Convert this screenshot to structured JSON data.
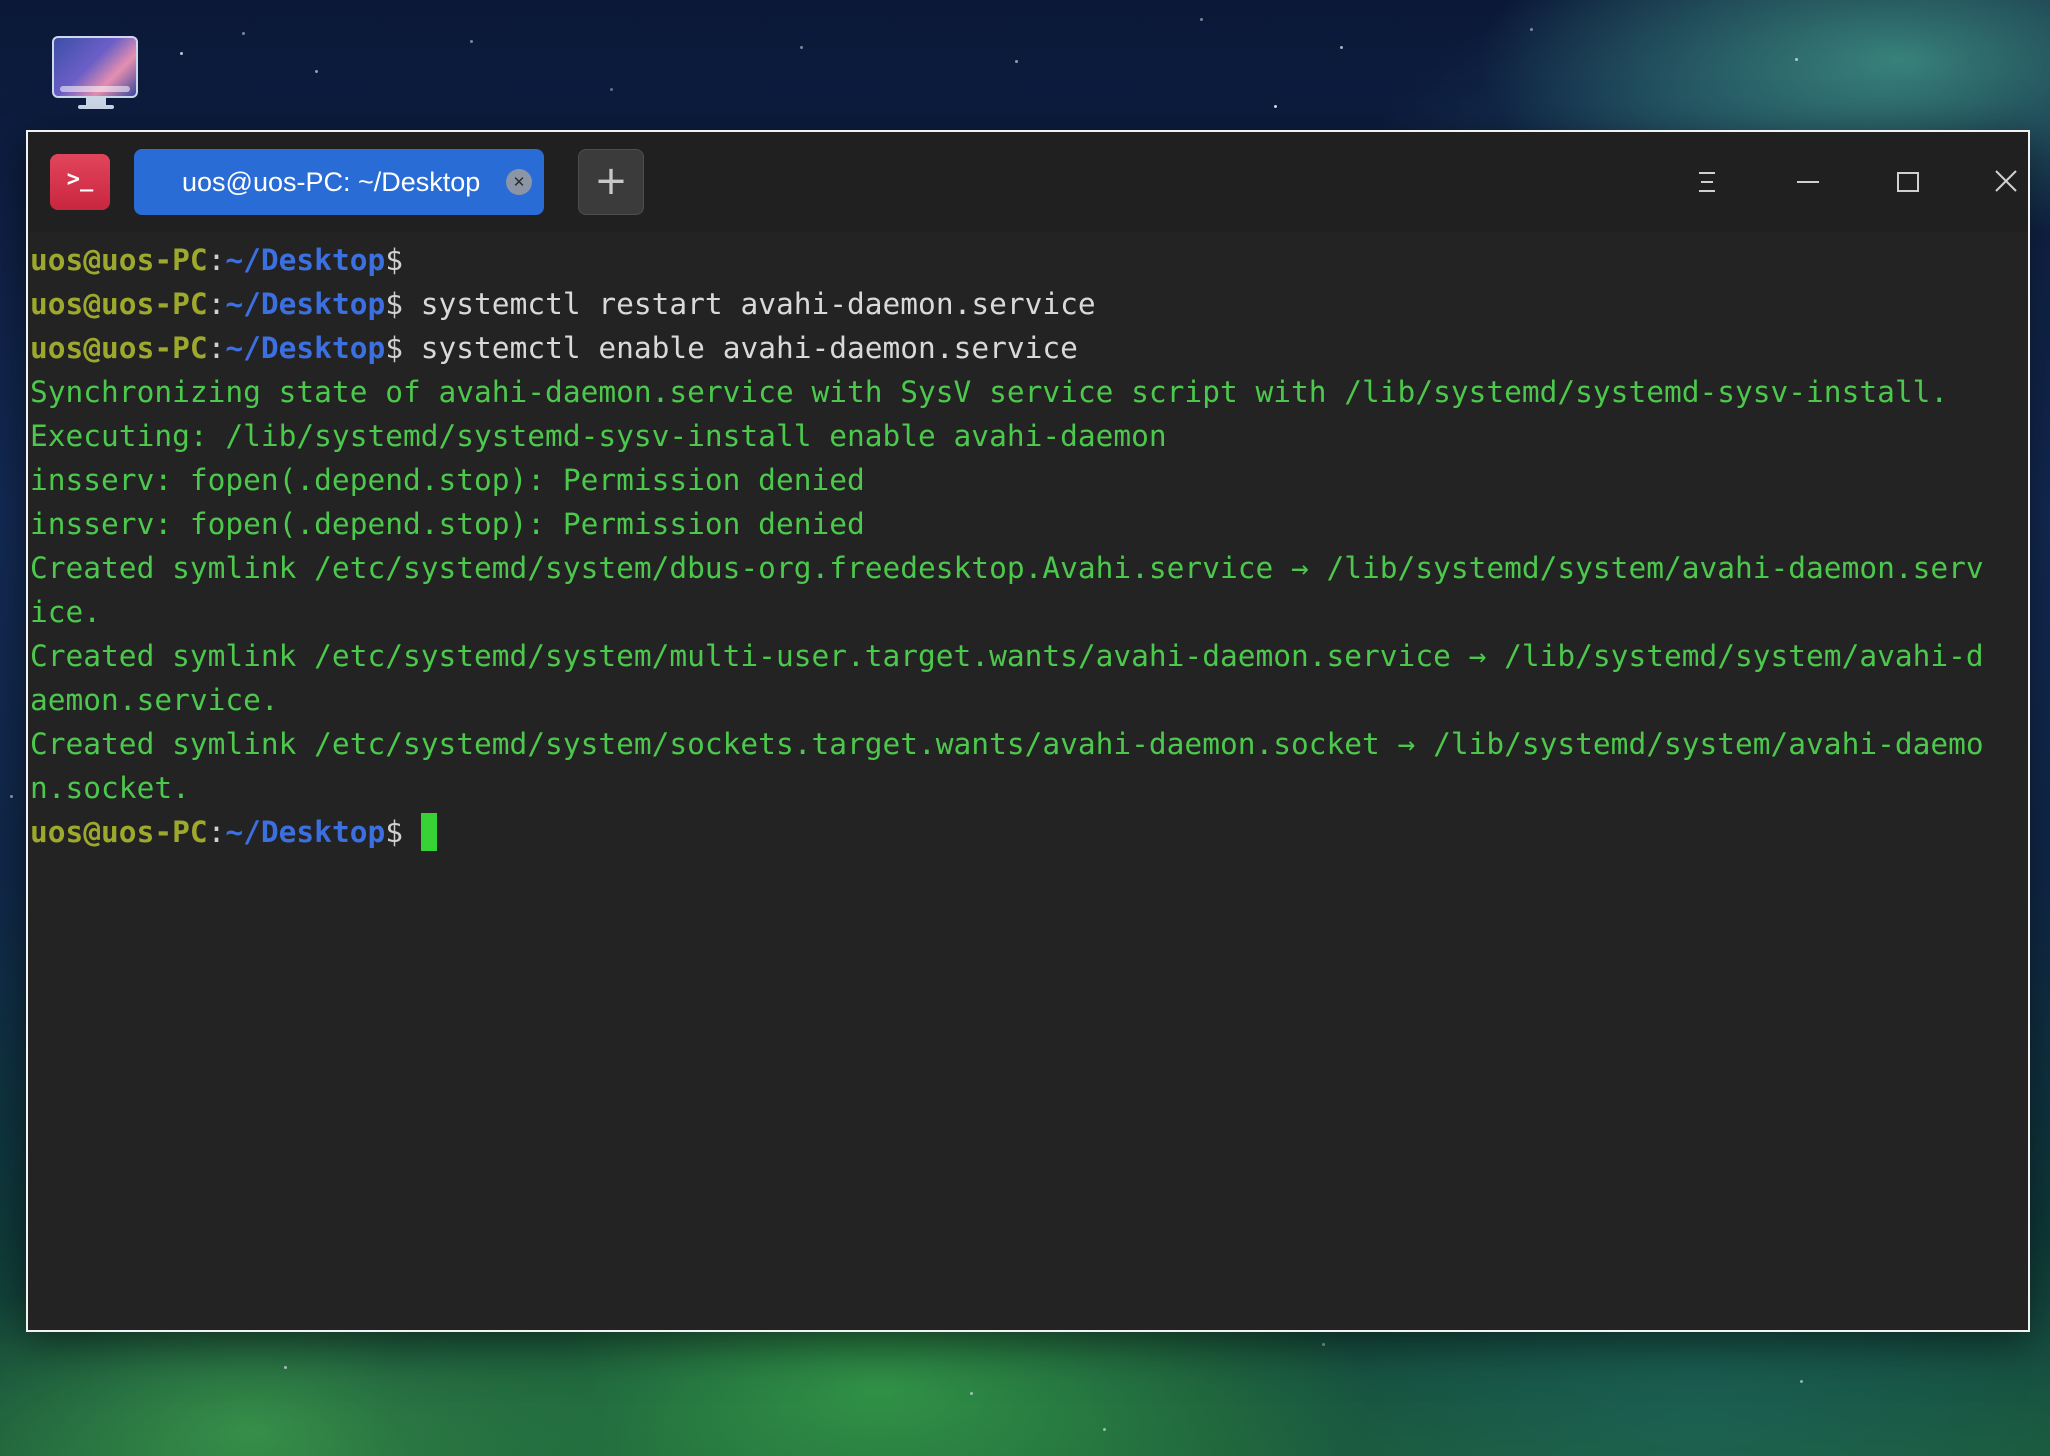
{
  "desktop": {
    "icons": [
      {
        "name": "computer-icon"
      }
    ]
  },
  "window": {
    "app_icon": "terminal-icon",
    "app_icon_text": ">_",
    "tabs": [
      {
        "label": "uos@uos-PC: ~/Desktop",
        "active": true
      }
    ],
    "new_tab_label": "+",
    "controls": [
      "menu-icon",
      "minimize-icon",
      "maximize-icon",
      "close-icon"
    ]
  },
  "terminal": {
    "prompt": {
      "user_host": "uos@uos-PC",
      "colon": ":",
      "path": "~/Desktop",
      "dollar": "$"
    },
    "lines": [
      {
        "type": "prompt",
        "command": ""
      },
      {
        "type": "prompt",
        "command": " systemctl restart avahi-daemon.service"
      },
      {
        "type": "prompt",
        "command": " systemctl enable avahi-daemon.service"
      },
      {
        "type": "output",
        "text": "Synchronizing state of avahi-daemon.service with SysV service script with /lib/systemd/systemd-sysv-install."
      },
      {
        "type": "output",
        "text": "Executing: /lib/systemd/systemd-sysv-install enable avahi-daemon"
      },
      {
        "type": "output",
        "text": "insserv: fopen(.depend.stop): Permission denied"
      },
      {
        "type": "output",
        "text": "insserv: fopen(.depend.stop): Permission denied"
      },
      {
        "type": "output",
        "text": "Created symlink /etc/systemd/system/dbus-org.freedesktop.Avahi.service → /lib/systemd/system/avahi-daemon.serv"
      },
      {
        "type": "output",
        "text": "ice."
      },
      {
        "type": "output",
        "text": "Created symlink /etc/systemd/system/multi-user.target.wants/avahi-daemon.service → /lib/systemd/system/avahi-d"
      },
      {
        "type": "output",
        "text": "aemon.service."
      },
      {
        "type": "output",
        "text": "Created symlink /etc/systemd/system/sockets.target.wants/avahi-daemon.socket → /lib/systemd/system/avahi-daemo"
      },
      {
        "type": "output",
        "text": "n.socket."
      },
      {
        "type": "prompt",
        "command": " ",
        "cursor": true
      }
    ]
  },
  "colors": {
    "prompt_user": "#9ea82c",
    "prompt_path": "#3c6fe0",
    "output_text": "#4cc84c",
    "command_text": "#d9d9d9",
    "tab_active": "#2a6cd6",
    "terminal_bg": "#232323",
    "cursor": "#36d236"
  }
}
